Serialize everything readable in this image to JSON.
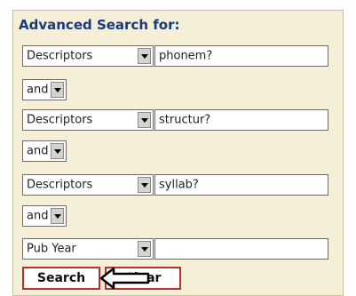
{
  "title": "Advanced Search for:",
  "rows": [
    {
      "field": "Descriptors",
      "term": "phonem?"
    },
    {
      "operator": "and"
    },
    {
      "field": "Descriptors",
      "term": "structur?"
    },
    {
      "operator": "and"
    },
    {
      "field": "Descriptors",
      "term": "syllab?"
    },
    {
      "operator": "and"
    },
    {
      "field": "Pub Year",
      "term": ""
    }
  ],
  "buttons": {
    "search": "Search",
    "clear": "Clear"
  },
  "icons": {
    "pointer": "left-arrow-icon"
  }
}
